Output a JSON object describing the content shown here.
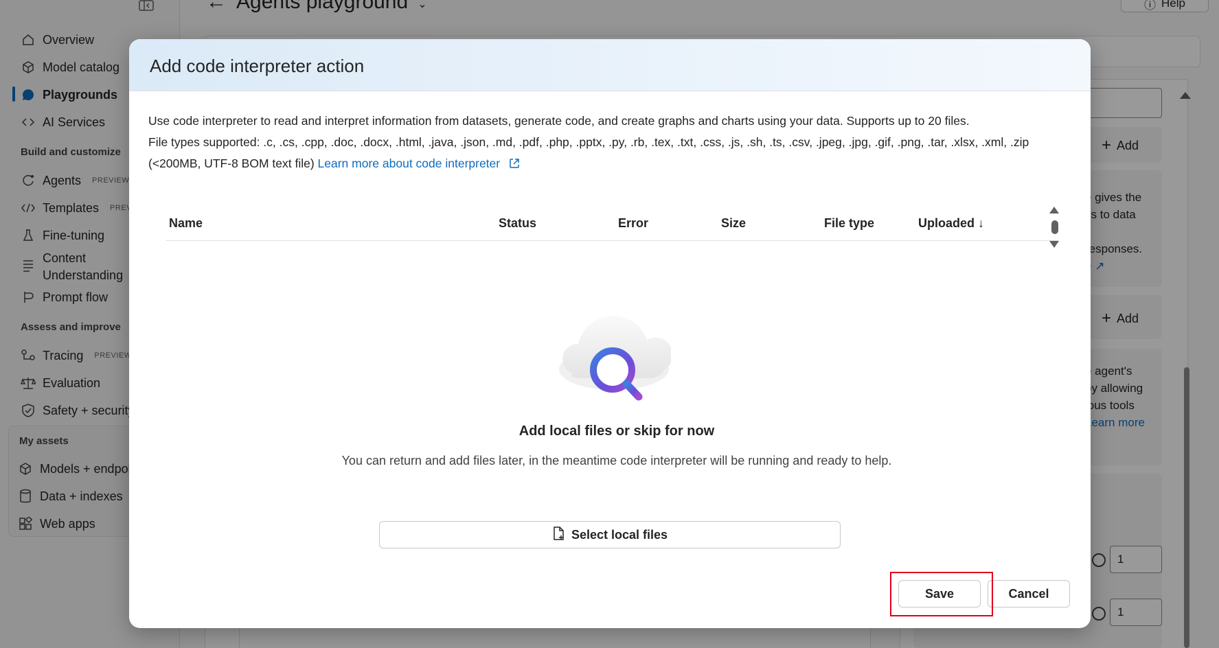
{
  "app": {
    "page_title": "Agents playground",
    "help_label": "Help"
  },
  "sidebar": {
    "top_items": [
      {
        "label": "Overview",
        "icon": "home-icon"
      },
      {
        "label": "Model catalog",
        "icon": "cube-icon"
      },
      {
        "label": "Playgrounds",
        "icon": "chat-icon",
        "active": true
      },
      {
        "label": "AI Services",
        "icon": "link-icon"
      }
    ],
    "build_section": "Build and customize",
    "build_items": [
      {
        "label": "Agents",
        "badge": "PREVIEW"
      },
      {
        "label": "Templates",
        "badge": "PREVIEW"
      },
      {
        "label": "Fine-tuning"
      },
      {
        "label": "Content",
        "label2": "Understanding"
      },
      {
        "label": "Prompt flow"
      }
    ],
    "assess_section": "Assess and improve",
    "assess_items": [
      {
        "label": "Tracing",
        "badge": "PREVIEW"
      },
      {
        "label": "Evaluation"
      },
      {
        "label": "Safety + security"
      }
    ],
    "assets_section": "My assets",
    "assets_items": [
      {
        "label": "Models + endpoints"
      },
      {
        "label": "Data + indexes"
      },
      {
        "label": "Web apps"
      }
    ]
  },
  "right_panel": {
    "add_label": "Add",
    "card1_lines": [
      "e gives the",
      "ss to data",
      "r",
      "responses."
    ],
    "card1_link": "e",
    "card2_lines": [
      "e agent's",
      "by allowing",
      "ious tools"
    ],
    "card2_link": "Learn more",
    "input1_value": "1",
    "input2_value": "1"
  },
  "dialog": {
    "title": "Add code interpreter action",
    "desc_line1": "Use code interpreter to read and interpret information from datasets, generate code, and create graphs and charts using your data. Supports up to 20 files.",
    "desc_line2": "File types supported: .c, .cs, .cpp, .doc, .docx, .html, .java, .json, .md, .pdf, .php, .pptx, .py, .rb, .tex, .txt, .css, .js, .sh, .ts, .csv, .jpeg, .jpg, .gif, .png, .tar, .xlsx, .xml, .zip",
    "desc_line3": "(<200MB, UTF-8 BOM text file)",
    "learn_more": "Learn more about code interpreter",
    "columns": [
      "Name",
      "Status",
      "Error",
      "Size",
      "File type",
      "Uploaded ↓"
    ],
    "empty_title": "Add local files or skip for now",
    "empty_subtitle": "You can return and add files later, in the meantime code interpreter will be running and ready to help.",
    "select_files_label": "Select local files",
    "save_label": "Save",
    "cancel_label": "Cancel"
  }
}
